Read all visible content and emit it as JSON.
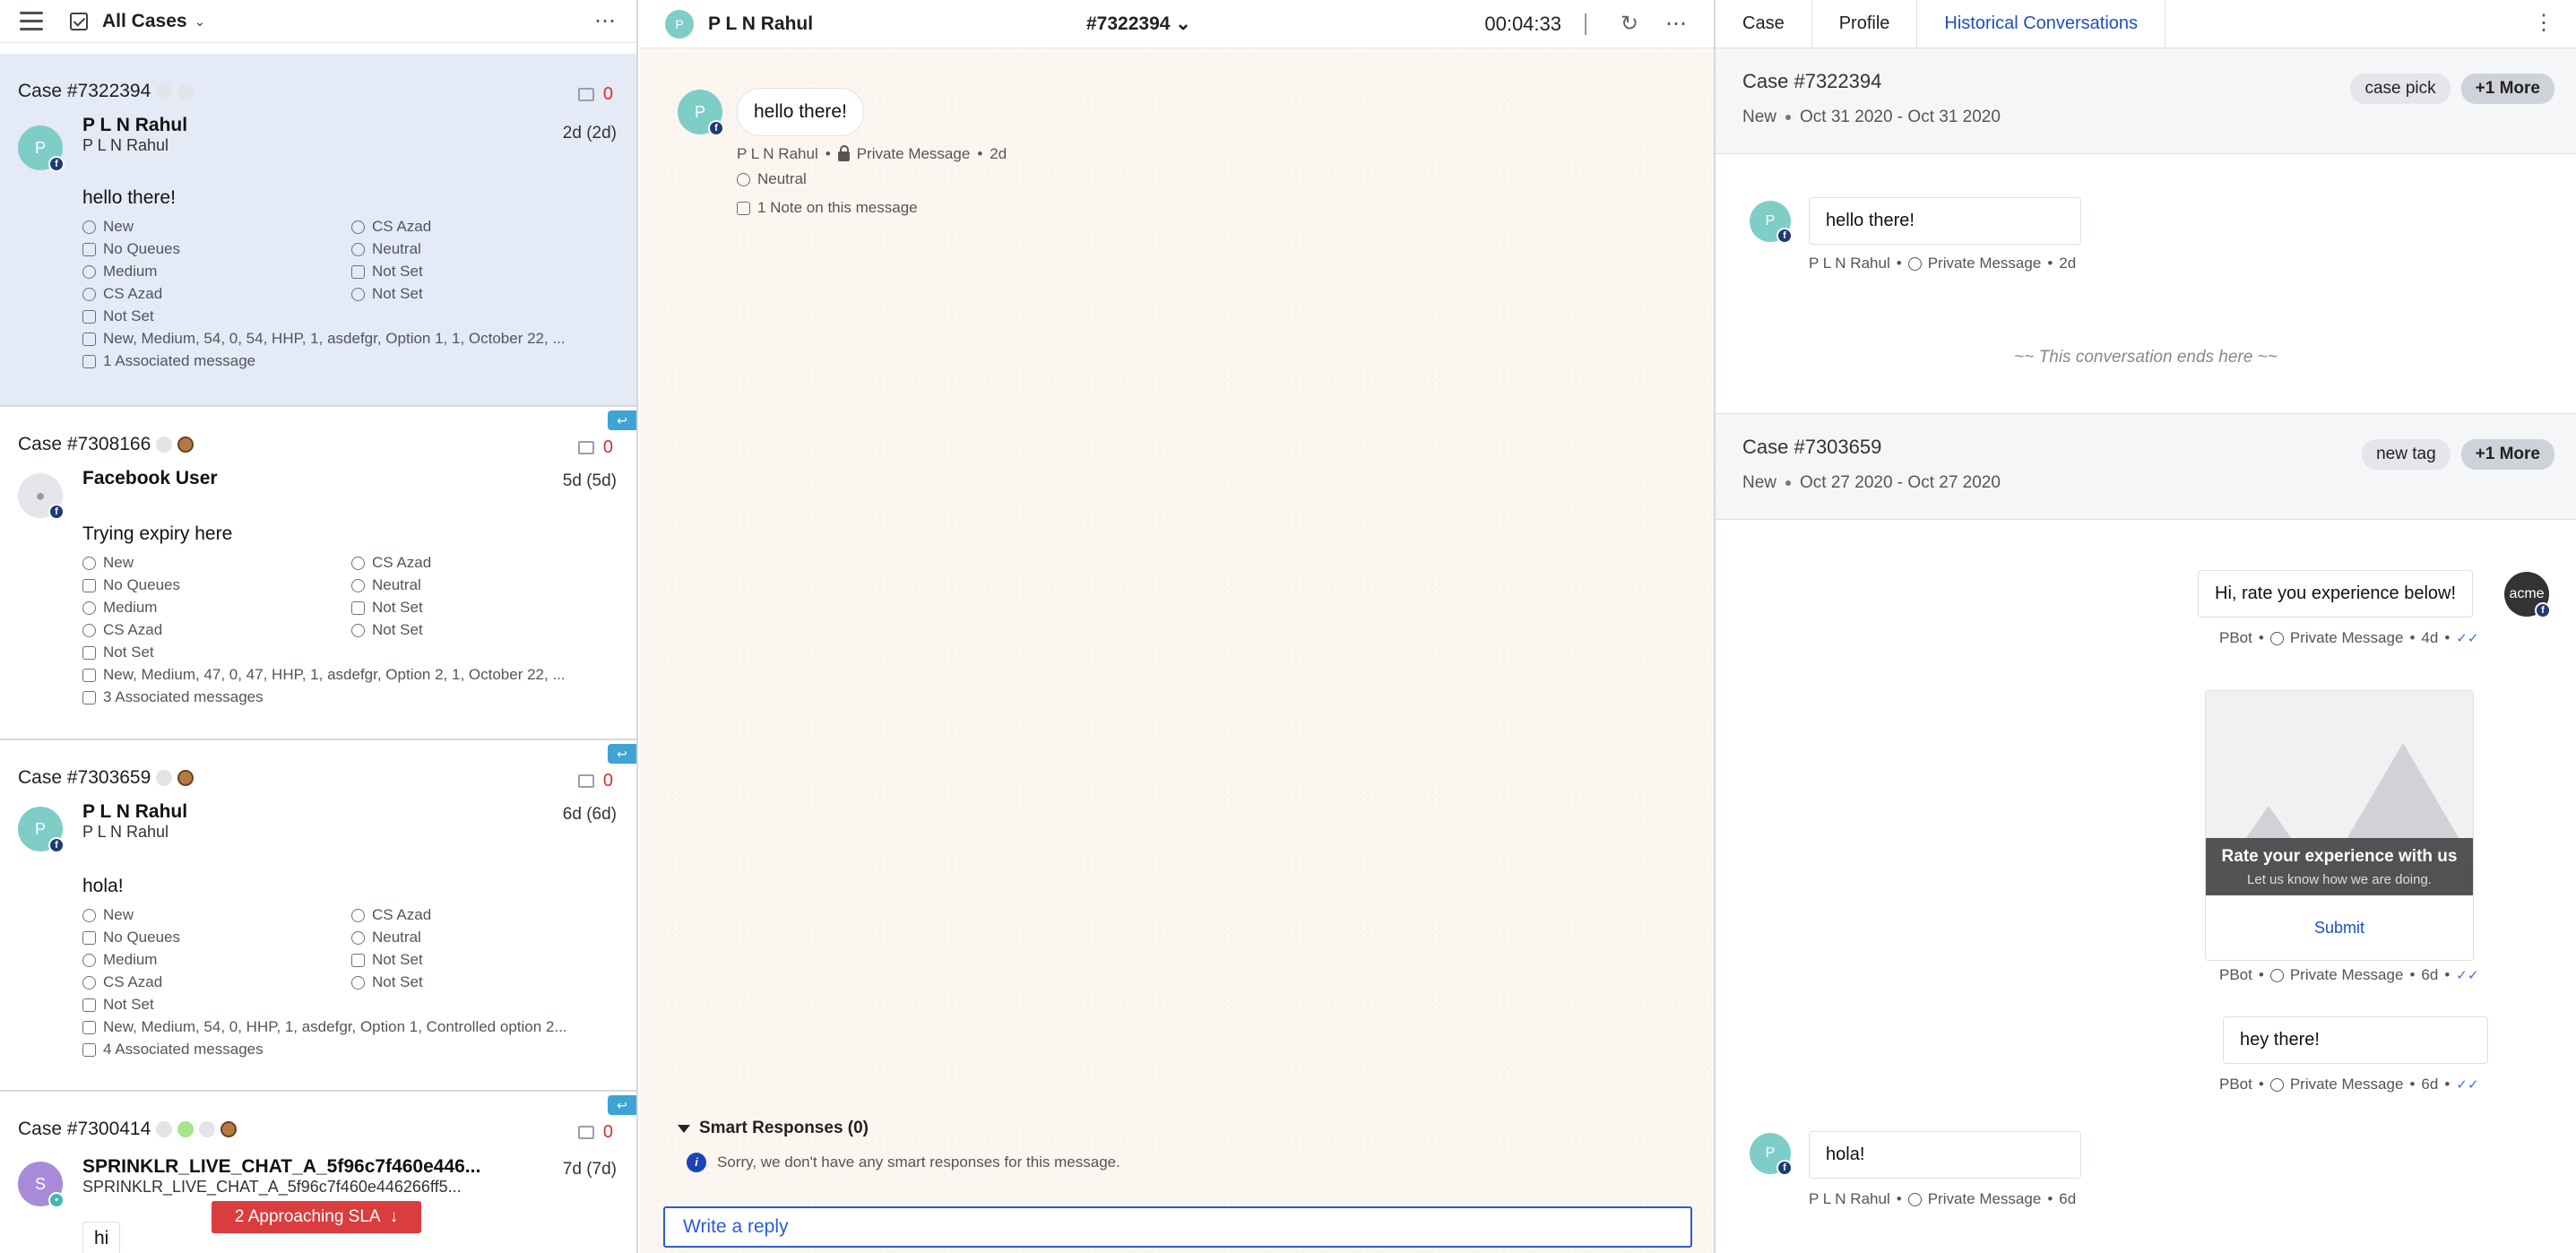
{
  "left": {
    "title": "All Cases",
    "cases": [
      {
        "id": "Case #7322394",
        "count": "0",
        "avatar": "P",
        "name": "P L N Rahul",
        "sub": "P L N Rahul",
        "time": "2d (2d)",
        "message": "hello there!",
        "status": "New",
        "agent": "CS Azad",
        "queue": "No Queues",
        "sentiment": "Neutral",
        "priority": "Medium",
        "f1": "Not Set",
        "assignee": "CS Azad",
        "f2": "Not Set",
        "tags": "Not Set",
        "fields": "New, Medium, 54, 0, 54, HHP, 1, asdefgr, Option 1, 1, October 22, ...",
        "associated": "1 Associated message"
      },
      {
        "id": "Case #7308166",
        "count": "0",
        "avatar": "",
        "name": "Facebook User",
        "sub": "",
        "time": "5d (5d)",
        "message": "Trying expiry here",
        "status": "New",
        "agent": "CS Azad",
        "queue": "No Queues",
        "sentiment": "Neutral",
        "priority": "Medium",
        "f1": "Not Set",
        "assignee": "CS Azad",
        "f2": "Not Set",
        "tags": "Not Set",
        "fields": "New, Medium, 47, 0, 47, HHP, 1, asdefgr, Option 2, 1, October 22, ...",
        "associated": "3 Associated messages"
      },
      {
        "id": "Case #7303659",
        "count": "0",
        "avatar": "P",
        "name": "P L N Rahul",
        "sub": "P L N Rahul",
        "time": "6d (6d)",
        "message": "hola!",
        "status": "New",
        "agent": "CS Azad",
        "queue": "No Queues",
        "sentiment": "Neutral",
        "priority": "Medium",
        "f1": "Not Set",
        "assignee": "CS Azad",
        "f2": "Not Set",
        "tags": "Not Set",
        "fields": "New, Medium, 54, 0, HHP, 1, asdefgr, Option 1, Controlled option 2...",
        "associated": "4 Associated messages"
      },
      {
        "id": "Case #7300414",
        "count": "0",
        "avatar": "S",
        "name": "SPRINKLR_LIVE_CHAT_A_5f96c7f460e446...",
        "sub": "SPRINKLR_LIVE_CHAT_A_5f96c7f460e446266ff5...",
        "time": "7d (7d)",
        "message": "hi"
      }
    ],
    "sla": "2 Approaching SLA"
  },
  "middle": {
    "avatar": "P",
    "name": "P L N Rahul",
    "case": "#7322394",
    "timer": "00:04:33",
    "message": "hello there!",
    "meta_author": "P L N Rahul",
    "meta_type": "Private Message",
    "meta_age": "2d",
    "sentiment": "Neutral",
    "note": "1 Note on this message",
    "smart_title": "Smart Responses (0)",
    "smart_msg": "Sorry, we don't have any smart responses for this message.",
    "reply_placeholder": "Write a reply"
  },
  "right": {
    "tabs": [
      "Case",
      "Profile",
      "Historical Conversations"
    ],
    "active_tab": "Historical Conversations",
    "conv1": {
      "title": "Case #7322394",
      "status": "New",
      "dates": "Oct 31 2020 - Oct 31 2020",
      "tag": "case pick",
      "more": "+1 More",
      "msg": "hello there!",
      "author": "P L N Rahul",
      "type": "Private Message",
      "age": "2d",
      "ends": "~~ This conversation ends here ~~"
    },
    "conv2": {
      "title": "Case #7303659",
      "status": "New",
      "dates": "Oct 27 2020 - Oct 27 2020",
      "tag": "new tag",
      "more": "+1 More",
      "bot_msg": "Hi, rate you experience below!",
      "bot_name": "PBot",
      "type": "Private Message",
      "age1": "4d",
      "bot_avatar": "acme",
      "card_title": "Rate your experience with us",
      "card_sub": "Let us know how we are doing.",
      "card_submit": "Submit",
      "age2": "6d",
      "msg2": "hey there!",
      "age3": "6d",
      "user_msg": "hola!",
      "author": "P L N Rahul",
      "age4": "6d"
    }
  },
  "colors": {
    "accent": "#1f4fc2",
    "sla": "#da3d3d",
    "active_case": "#e5eaf7",
    "avatar": "#7fcdc7"
  }
}
